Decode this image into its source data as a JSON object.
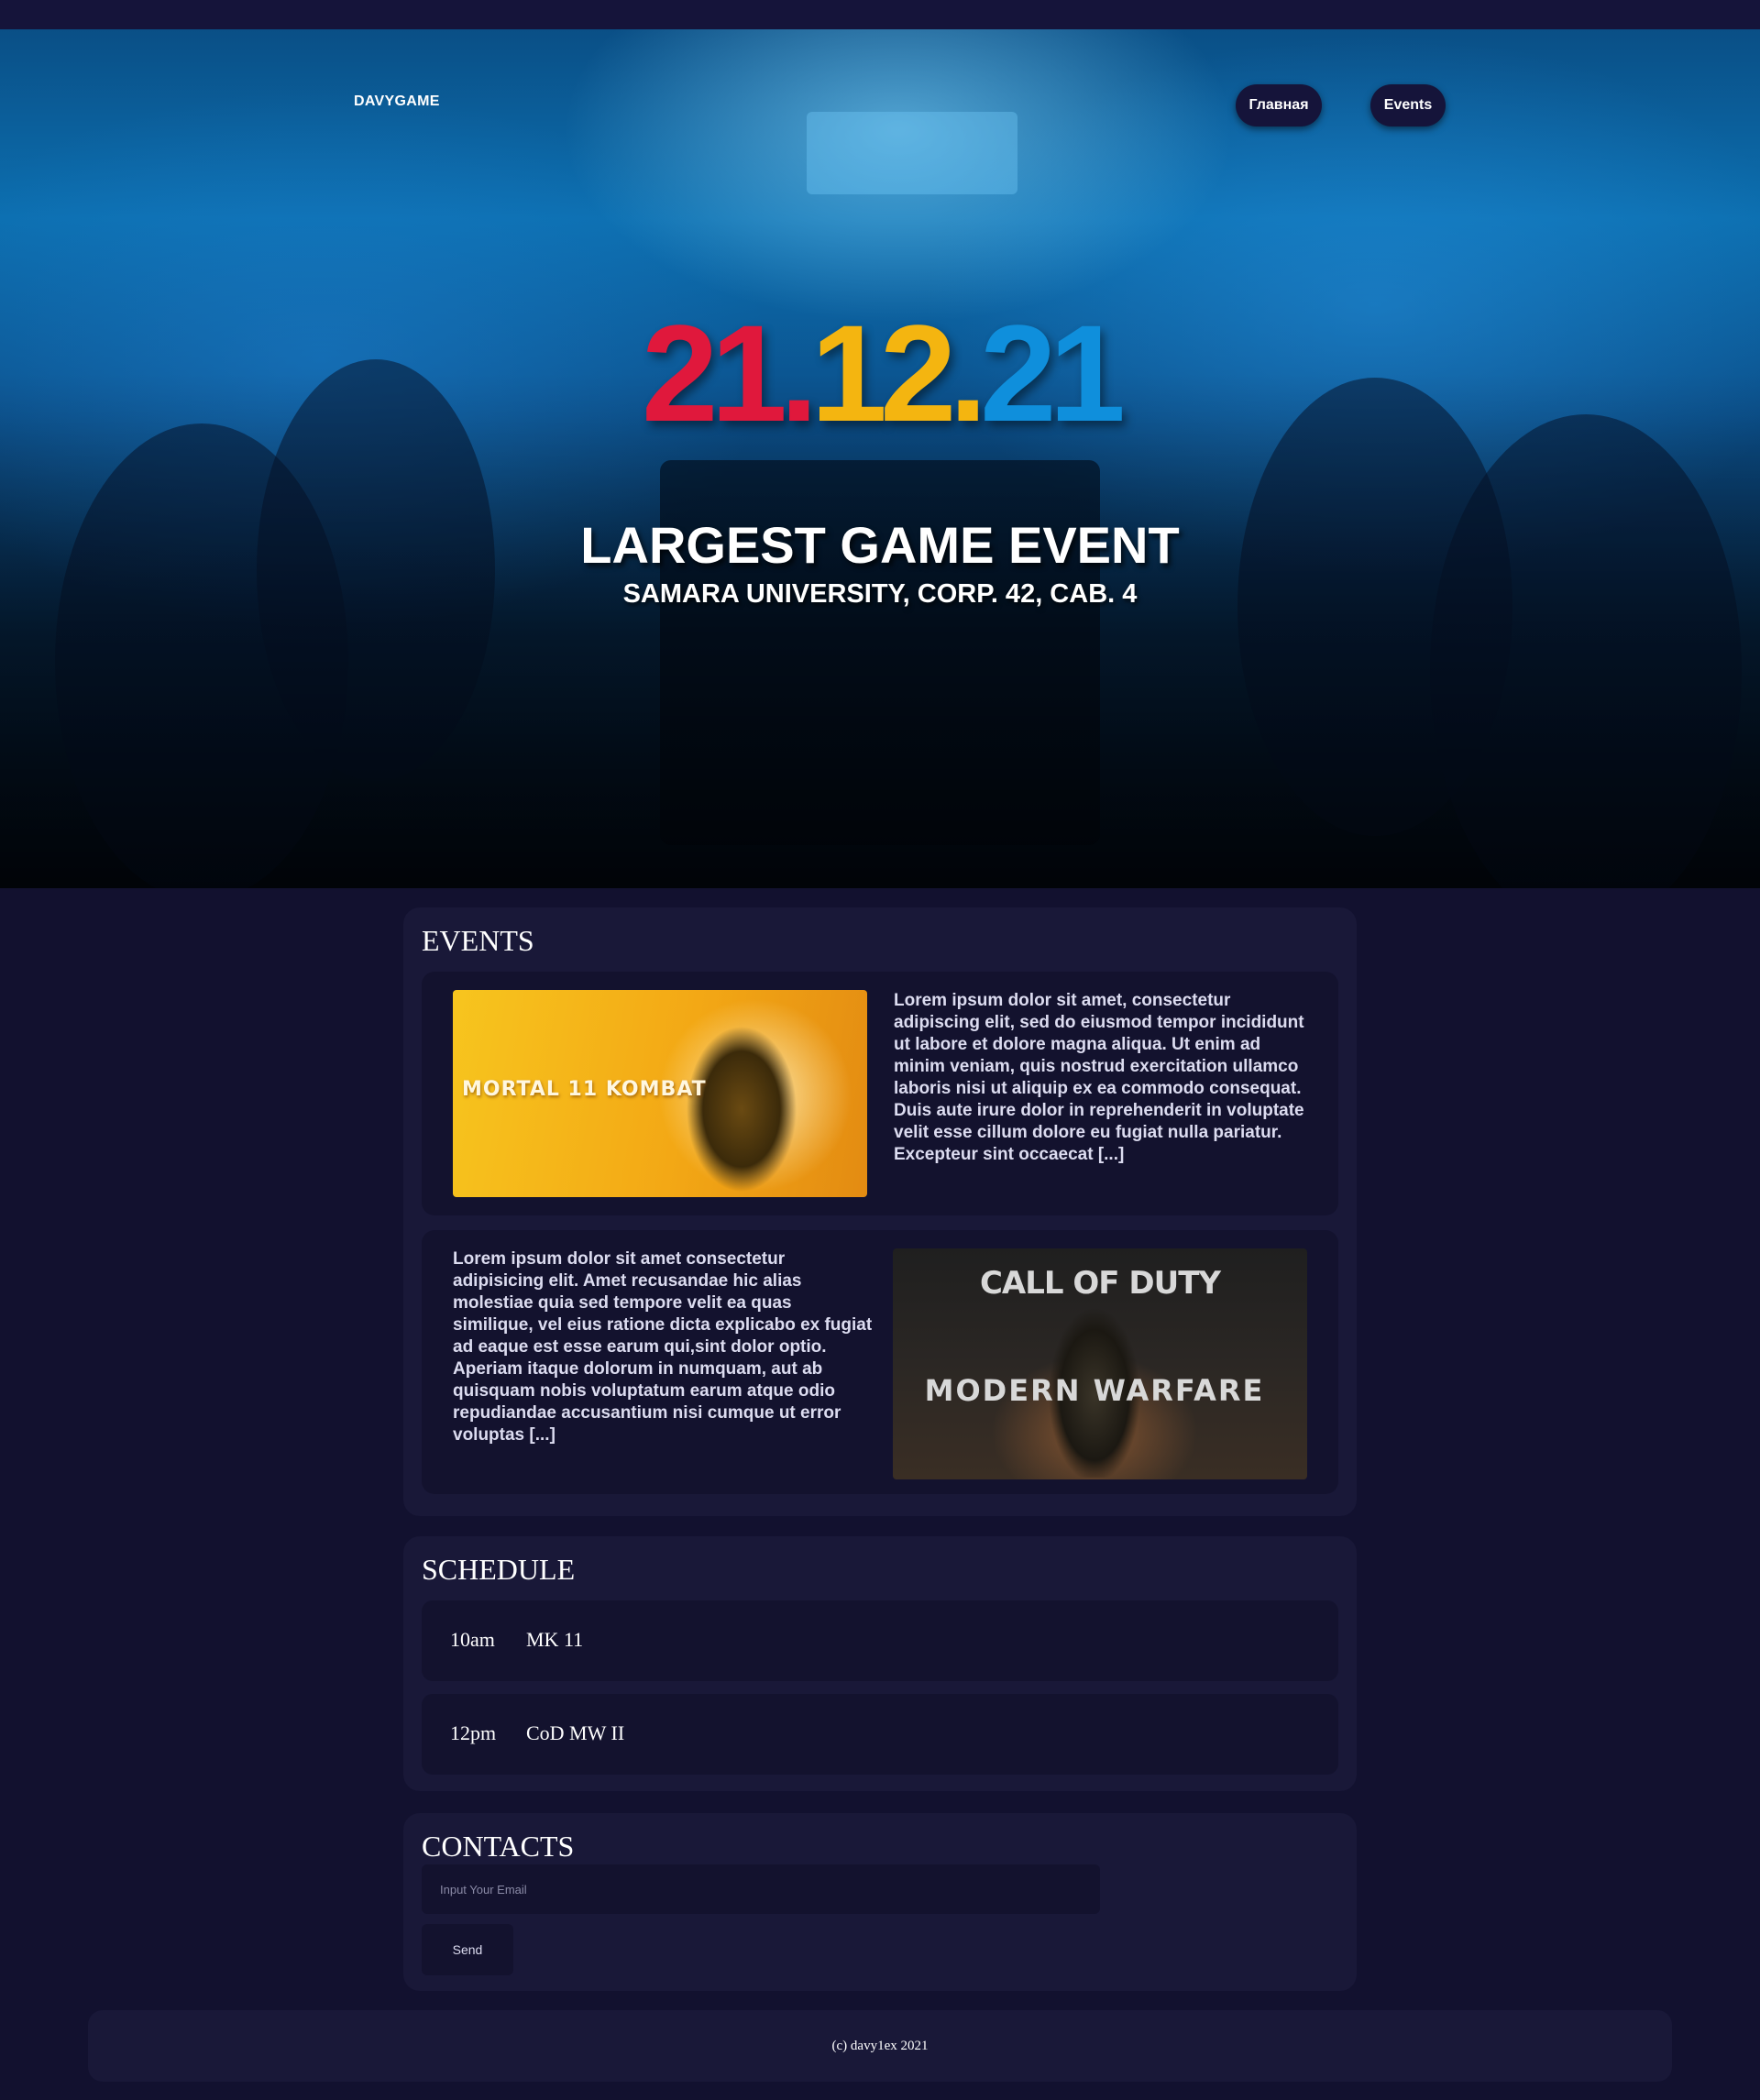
{
  "header": {
    "logo": "DAVYGAME",
    "nav": [
      {
        "label": "Главная"
      },
      {
        "label": "Events"
      }
    ]
  },
  "hero": {
    "date_parts": [
      "21.",
      "12.",
      "21"
    ],
    "colors": [
      "#e0183c",
      "#f4b510",
      "#0f8fdc"
    ],
    "title": "LARGEST GAME EVENT",
    "subtitle": "SAMARA UNIVERSITY, CORP. 42, CAB. 4"
  },
  "events": {
    "heading": "EVENTS",
    "items": [
      {
        "image_label": "MORTAL 11 KOMBAT",
        "text": "Lorem ipsum dolor sit amet, consectetur adipiscing elit, sed do eiusmod tempor incididunt ut labore et dolore magna aliqua. Ut enim ad minim veniam, quis nostrud exercitation ullamco laboris nisi ut aliquip ex ea commodo consequat. Duis aute irure dolor in reprehenderit in voluptate velit esse cillum dolore eu fugiat nulla pariatur. Excepteur sint occaecat [...]"
      },
      {
        "image_label_top": "CALL OF DUTY",
        "image_label_bottom": "MODERN WARFARE",
        "text": "Lorem ipsum dolor sit amet consectetur adipisicing elit. Amet recusandae hic alias molestiae quia sed tempore velit ea quas similique, vel eius ratione dicta explicabo ex fugiat ad eaque est esse earum qui,sint dolor optio. Aperiam itaque dolorum in numquam, aut ab quisquam nobis voluptatum earum atque odio repudiandae accusantium nisi cumque ut error voluptas [...]"
      }
    ]
  },
  "schedule": {
    "heading": "SCHEDULE",
    "rows": [
      {
        "time": "10am",
        "game": "MK 11"
      },
      {
        "time": "12pm",
        "game": "CoD MW II"
      }
    ]
  },
  "contacts": {
    "heading": "CONTACTS",
    "email_placeholder": "Input Your Email",
    "email_value": "",
    "send_label": "Send"
  },
  "footer": {
    "text": "(c) davy1ex 2021"
  }
}
